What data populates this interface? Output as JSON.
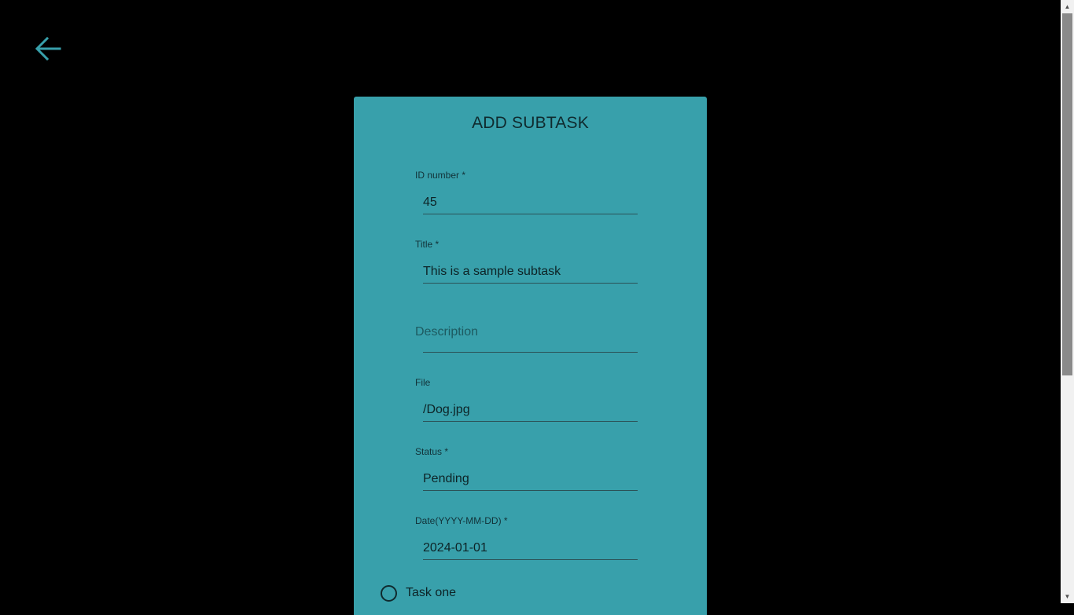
{
  "page": {
    "back_icon": "arrow-left-icon"
  },
  "form": {
    "title": "ADD SUBTASK",
    "fields": [
      {
        "label": "ID number *",
        "value": "45"
      },
      {
        "label": "Title *",
        "value": "This is a sample subtask"
      },
      {
        "placeholder": "Description",
        "value": ""
      },
      {
        "label": "File",
        "value": "/Dog.jpg"
      },
      {
        "label": "Status *",
        "value": "Pending"
      },
      {
        "label": "Date(YYYY-MM-DD) *",
        "value": "2024-01-01"
      }
    ],
    "radio": {
      "label": "Task one",
      "checked": false
    }
  },
  "colors": {
    "background": "#000000",
    "card": "#38a0ab",
    "accent": "#38a0ab",
    "text": "#0d2326"
  }
}
